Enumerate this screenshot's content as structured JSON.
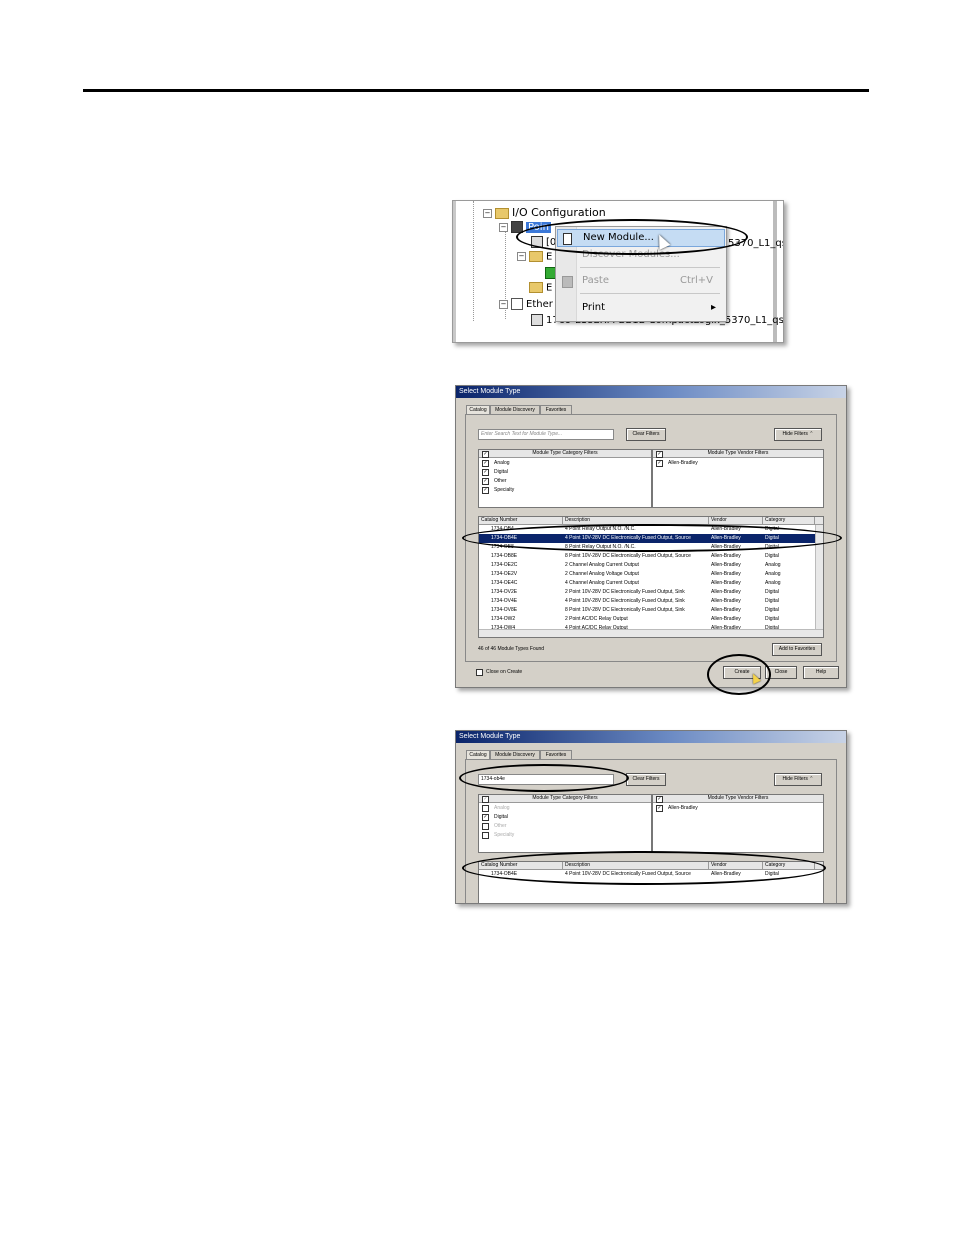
{
  "tree": {
    "io_config": "I/O Configuration",
    "point_partial": "Poin",
    "module_partial": "[0",
    "module_suffix": "5370_L1_qs",
    "e1": "E",
    "e2": "E",
    "ether": "Ether",
    "ether_module": "1769-L18ERM-BB1B CompactLogix_5370_L1_qs"
  },
  "context_menu": {
    "new_module": "New Module...",
    "discover": "Discover Modules...",
    "paste": "Paste",
    "paste_shortcut": "Ctrl+V",
    "print": "Print",
    "submenu_arrow": "▸"
  },
  "dialog1": {
    "title": "Select Module Type",
    "tabs": [
      "Catalog",
      "Module Discovery",
      "Favorites"
    ],
    "search_placeholder": "Enter Search Text for Module Type...",
    "clear_filters": "Clear Filters",
    "hide_filters": "Hide Filters",
    "category_header": "Module Type Category Filters",
    "vendor_header": "Module Type Vendor Filters",
    "categories": [
      "Analog",
      "Digital",
      "Other",
      "Specialty"
    ],
    "vendors": [
      "Allen-Bradley"
    ],
    "columns": [
      "Catalog Number",
      "Description",
      "Vendor",
      "Category"
    ],
    "rows": [
      [
        "1734-OB4",
        "4 Point Relay Output N.O. /N.C.",
        "Allen-Bradley",
        "Digital"
      ],
      [
        "1734-OB4E",
        "4 Point 10V-28V DC Electronically Fused Output, Source",
        "Allen-Bradley",
        "Digital"
      ],
      [
        "1734-OB8",
        "8 Point Relay Output N.O. /N.C.",
        "Allen-Bradley",
        "Digital"
      ],
      [
        "1734-OB8E",
        "8 Point 10V-28V DC Electronically Fused Output, Source",
        "Allen-Bradley",
        "Digital"
      ],
      [
        "1734-OE2C",
        "2 Channel Analog Current Output",
        "Allen-Bradley",
        "Analog"
      ],
      [
        "1734-OE2V",
        "2 Channel Analog Voltage Output",
        "Allen-Bradley",
        "Analog"
      ],
      [
        "1734-OE4C",
        "4 Channel Analog Current Output",
        "Allen-Bradley",
        "Analog"
      ],
      [
        "1734-OV2E",
        "2 Point 10V-28V DC Electronically Fused Output, Sink",
        "Allen-Bradley",
        "Digital"
      ],
      [
        "1734-OV4E",
        "4 Point 10V-28V DC Electronically Fused Output, Sink",
        "Allen-Bradley",
        "Digital"
      ],
      [
        "1734-OV8E",
        "8 Point 10V-28V DC Electronically Fused Output, Sink",
        "Allen-Bradley",
        "Digital"
      ],
      [
        "1734-OW2",
        "2 Point AC/DC Relay Output",
        "Allen-Bradley",
        "Digital"
      ],
      [
        "1734-OW4",
        "4 Point AC/DC Relay Output",
        "Allen-Bradley",
        "Digital"
      ]
    ],
    "found": "46  of 46 Module Types Found",
    "add_favorites": "Add to Favorites",
    "close_on_create": "Close on Create",
    "create": "Create",
    "close": "Close",
    "help": "Help"
  },
  "dialog2": {
    "title": "Select Module Type",
    "tabs": [
      "Catalog",
      "Module Discovery",
      "Favorites"
    ],
    "search_value": "1734-ob4e",
    "clear_filters": "Clear Filters",
    "hide_filters": "Hide Filters",
    "category_header": "Module Type Category Filters",
    "vendor_header": "Module Type Vendor Filters",
    "categories": [
      "Analog",
      "Digital",
      "Other",
      "Specialty"
    ],
    "vendors": [
      "Allen-Bradley"
    ],
    "columns": [
      "Catalog Number",
      "Description",
      "Vendor",
      "Category"
    ],
    "rows": [
      [
        "1734-OB4E",
        "4 Point 10V-28V DC Electronically Fused Output, Source",
        "Allen-Bradley",
        "Digital"
      ]
    ]
  }
}
